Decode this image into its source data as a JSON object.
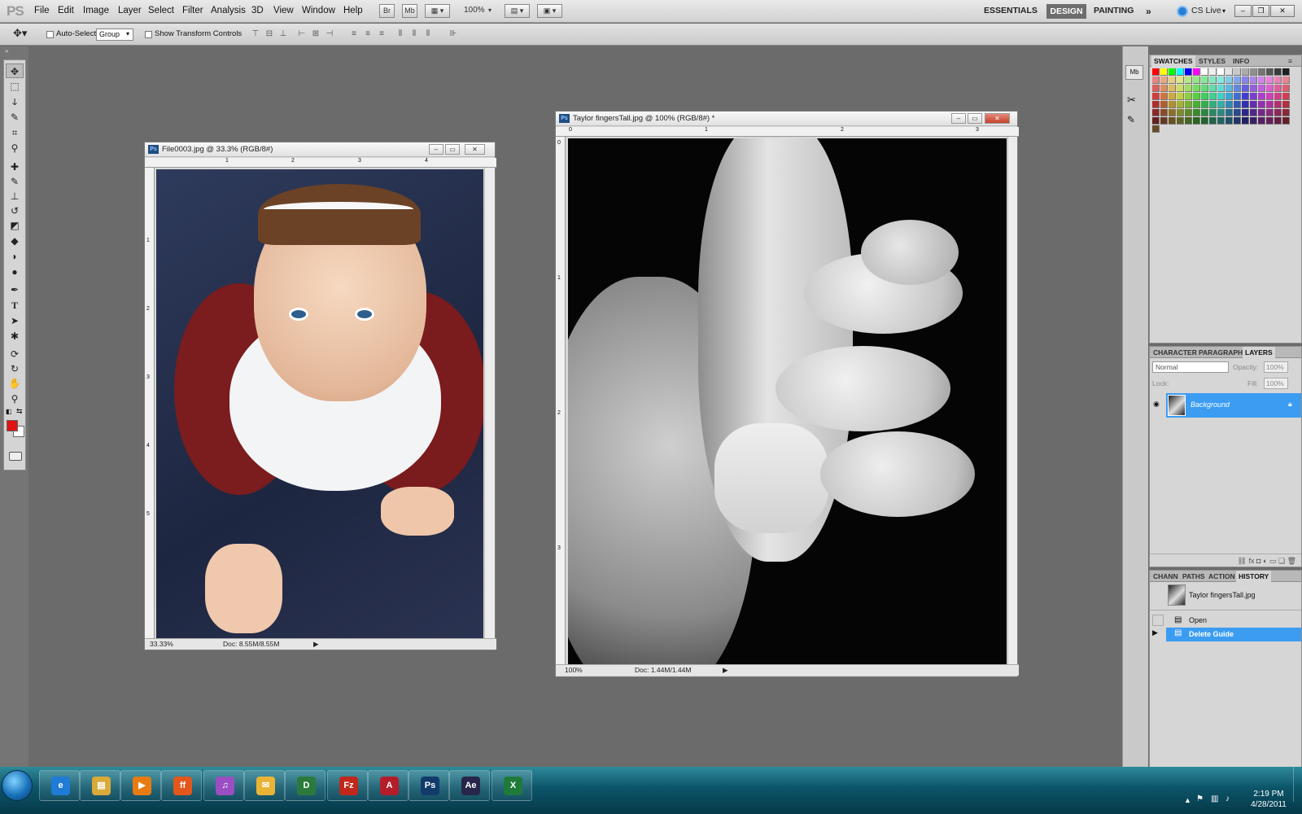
{
  "app": {
    "logo": "PS"
  },
  "menubar": {
    "items": [
      "File",
      "Edit",
      "Image",
      "Layer",
      "Select",
      "Filter",
      "Analysis",
      "3D",
      "View",
      "Window",
      "Help"
    ],
    "bridge": "Br",
    "minibridge": "Mb",
    "zoom": "100%",
    "workspaces": {
      "essentials": "ESSENTIALS",
      "design": "DESIGN",
      "painting": "PAINTING"
    },
    "cslive": "CS Live"
  },
  "options": {
    "auto_select_label": "Auto-Select:",
    "auto_select_value": "Group",
    "show_transform_label": "Show Transform Controls"
  },
  "colors": {
    "foreground": "#e01212",
    "background": "#ffffff",
    "accent": "#3b9cf2"
  },
  "doc1": {
    "title": "File0003.jpg @ 33.3% (RGB/8#)",
    "zoom": "33.33%",
    "docsize": "Doc: 8.55M/8.55M",
    "ruler_h": [
      "1",
      "2",
      "3",
      "4"
    ],
    "ruler_v": [
      "1",
      "2",
      "3",
      "4",
      "5"
    ]
  },
  "doc2": {
    "title": "Taylor fingersTall.jpg @ 100% (RGB/8#) *",
    "zoom": "100%",
    "docsize": "Doc: 1.44M/1.44M",
    "ruler_h": [
      "0",
      "1",
      "2",
      "3"
    ],
    "ruler_v": [
      "0",
      "1",
      "2",
      "3"
    ]
  },
  "swatches_panel": {
    "tabs": [
      "SWATCHES",
      "STYLES",
      "INFO"
    ]
  },
  "layers_panel": {
    "tabs": [
      "CHARACTER",
      "PARAGRAPH",
      "LAYERS"
    ],
    "blend_mode": "Normal",
    "opacity_label": "Opacity:",
    "opacity_value": "100%",
    "lock_label": "Lock:",
    "fill_label": "Fill:",
    "fill_value": "100%",
    "layer_name": "Background"
  },
  "history_panel": {
    "tabs": [
      "CHANN",
      "PATHS",
      "ACTION",
      "HISTORY"
    ],
    "snapshot": "Taylor fingersTall.jpg",
    "items": [
      "Open",
      "Delete Guide"
    ]
  },
  "taskbar": {
    "apps": [
      {
        "name": "internet-explorer",
        "label": "e",
        "color": "#1f7bd6"
      },
      {
        "name": "windows-explorer",
        "label": "▤",
        "color": "#d9a93a"
      },
      {
        "name": "media-player",
        "label": "▶",
        "color": "#e77b12"
      },
      {
        "name": "firefox",
        "label": "ff",
        "color": "#e2571b"
      },
      {
        "name": "itunes",
        "label": "♫",
        "color": "#9b4ec2"
      },
      {
        "name": "outlook",
        "label": "✉",
        "color": "#e9b335"
      },
      {
        "name": "dreamweaver",
        "label": "D",
        "color": "#2b7a3c"
      },
      {
        "name": "filezilla",
        "label": "Fz",
        "color": "#c1271b"
      },
      {
        "name": "acrobat",
        "label": "A",
        "color": "#b51d2a"
      },
      {
        "name": "photoshop",
        "label": "Ps",
        "color": "#123b6b"
      },
      {
        "name": "after-effects",
        "label": "Ae",
        "color": "#27264a"
      },
      {
        "name": "excel",
        "label": "X",
        "color": "#1f7a3a"
      }
    ],
    "time": "2:19 PM",
    "date": "4/28/2011"
  }
}
